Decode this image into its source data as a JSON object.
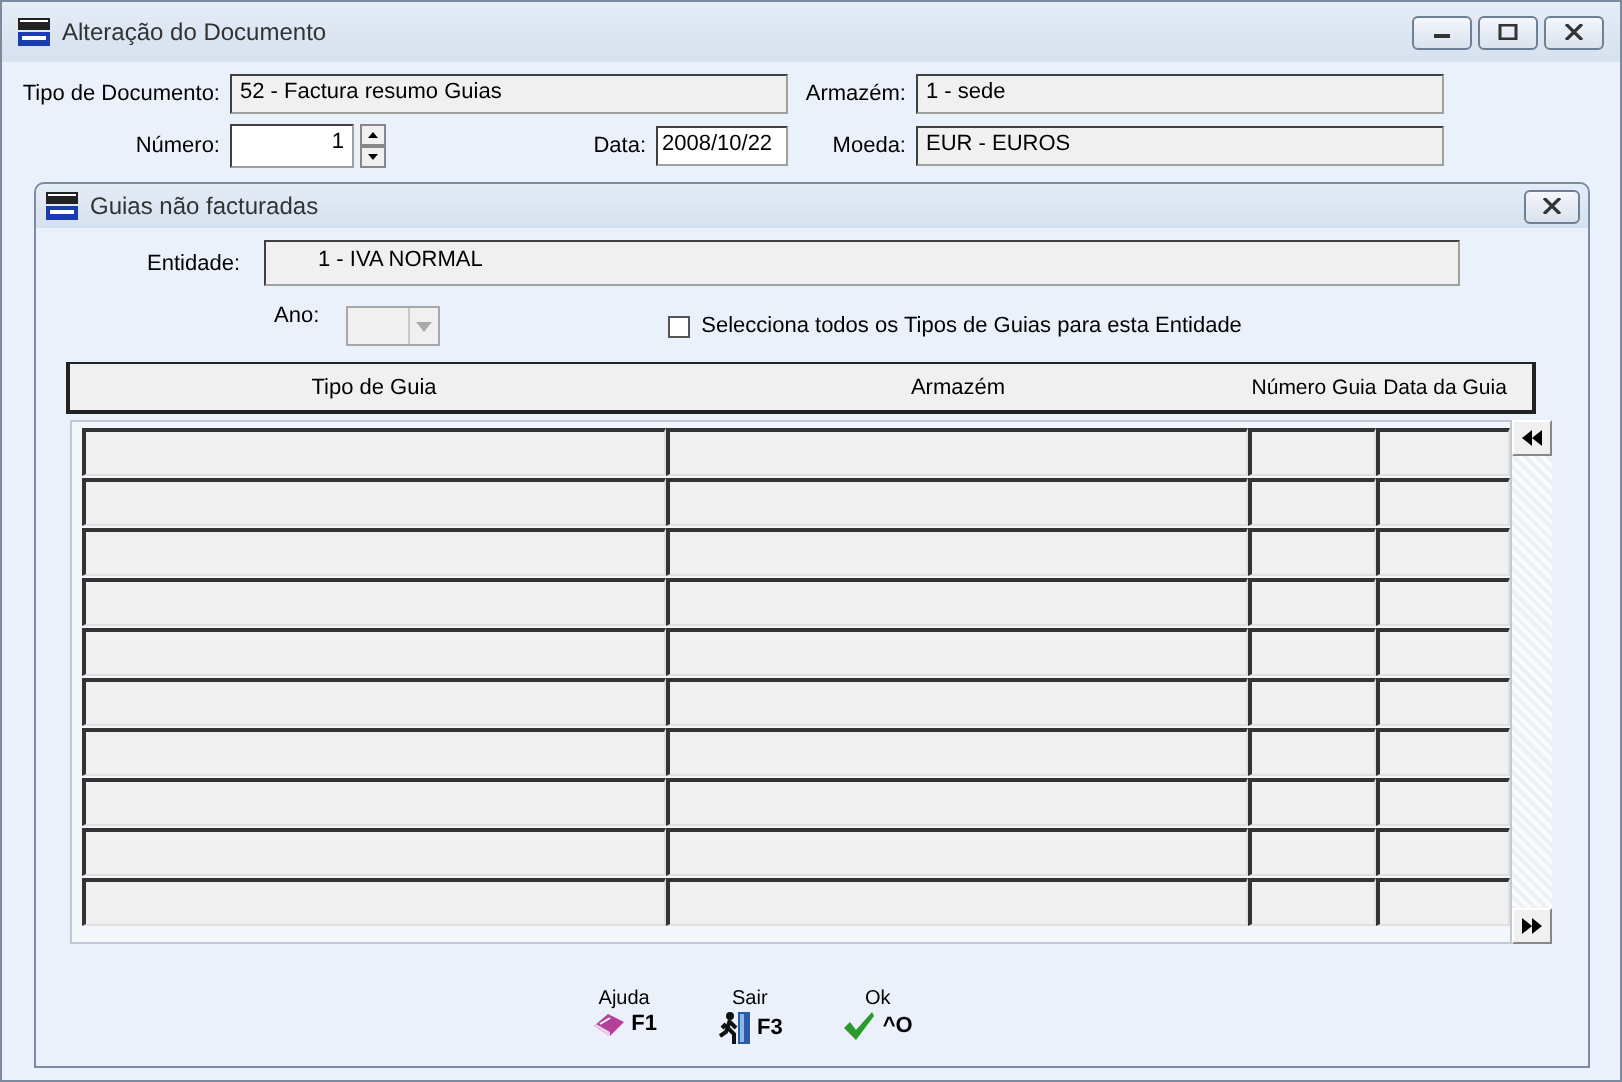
{
  "window": {
    "title": "Alteração do Documento"
  },
  "form": {
    "tipo_label": "Tipo de Documento:",
    "tipo_value": "52 - Factura resumo Guias",
    "armazem_label": "Armazém:",
    "armazem_value": "1 - sede",
    "numero_label": "Número:",
    "numero_value": "1",
    "data_label": "Data:",
    "data_value": "2008/10/22",
    "moeda_label": "Moeda:",
    "moeda_value": "EUR - EUROS"
  },
  "dialog": {
    "title": "Guias não facturadas",
    "entidade_label": "Entidade:",
    "entidade_value": "1 - IVA NORMAL",
    "ano_label": "Ano:",
    "ano_disabled": true,
    "select_all": {
      "label": "Selecciona todos os Tipos de Guias para esta Entidade",
      "checked": false
    },
    "table": {
      "columns": [
        "Tipo de Guia",
        "Armazém",
        "Número Guia",
        "Data da Guia"
      ],
      "rows": [
        {
          "kind": "empty"
        },
        {
          "kind": "empty"
        },
        {
          "kind": "empty"
        },
        {
          "kind": "empty"
        },
        {
          "kind": "empty"
        },
        {
          "kind": "empty"
        },
        {
          "kind": "empty"
        },
        {
          "kind": "empty"
        },
        {
          "kind": "empty"
        },
        {
          "kind": "empty"
        }
      ]
    },
    "buttons": [
      {
        "label": "Ajuda",
        "key": "F1",
        "kind": "help"
      },
      {
        "label": "Sair",
        "key": "F3",
        "kind": "exit"
      },
      {
        "label": "Ok",
        "key": "^O",
        "kind": "ok"
      }
    ]
  }
}
